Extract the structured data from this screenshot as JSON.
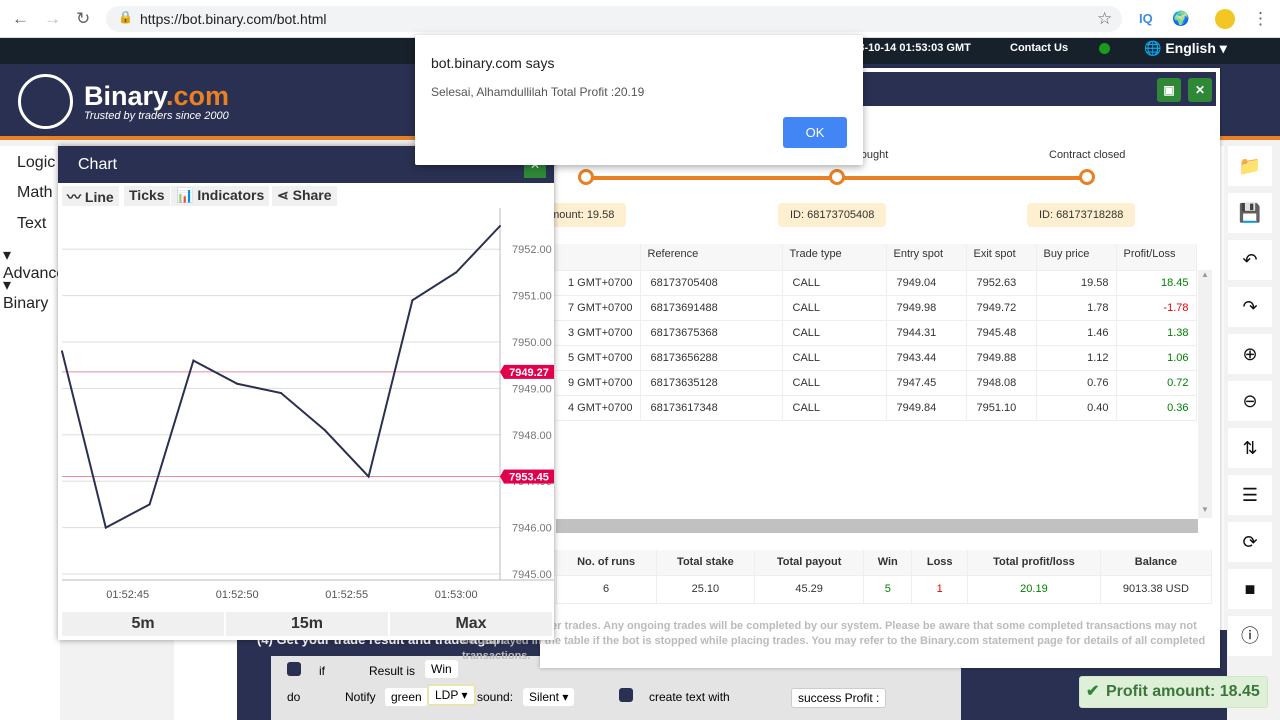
{
  "browser": {
    "url": "https://bot.binary.com/bot.html"
  },
  "topbar": {
    "time": "2018-10-14 01:53:03 GMT",
    "contact": "Contact Us",
    "language": "English"
  },
  "header": {
    "brand_main": "Binary",
    "brand_suffix": ".com",
    "tagline": "Trusted by traders since 2000"
  },
  "toolbox": {
    "items": [
      "Logic",
      "Math",
      "Text",
      "Advanced",
      "Binary"
    ]
  },
  "dialog": {
    "title": "bot.binary.com says",
    "message": "Selesai, Alhamdullilah Total Profit :20.19",
    "ok": "OK"
  },
  "steps": [
    {
      "label": "",
      "tip": "Buy amount: 19.58"
    },
    {
      "label": "Contract bought",
      "tip": "ID: 68173705408"
    },
    {
      "label": "Contract closed",
      "tip": "ID: 68173718288"
    }
  ],
  "trades": {
    "headers": [
      "Timestamp",
      "Reference",
      "Trade type",
      "Entry spot",
      "Exit spot",
      "Buy price",
      "Profit/Loss"
    ],
    "rows": [
      [
        "1 GMT+0700",
        "68173705408",
        "CALL",
        "7949.04",
        "7952.63",
        "19.58",
        "18.45"
      ],
      [
        "7 GMT+0700",
        "68173691488",
        "CALL",
        "7949.98",
        "7949.72",
        "1.78",
        "-1.78"
      ],
      [
        "3 GMT+0700",
        "68173675368",
        "CALL",
        "7944.31",
        "7945.48",
        "1.46",
        "1.38"
      ],
      [
        "5 GMT+0700",
        "68173656288",
        "CALL",
        "7943.44",
        "7949.88",
        "1.12",
        "1.06"
      ],
      [
        "9 GMT+0700",
        "68173635128",
        "CALL",
        "7947.45",
        "7948.08",
        "0.76",
        "0.72"
      ],
      [
        "4 GMT+0700",
        "68173617348",
        "CALL",
        "7949.84",
        "7951.10",
        "0.40",
        "0.36"
      ]
    ]
  },
  "summary": {
    "headers": [
      "No. of runs",
      "Total stake",
      "Total payout",
      "Win",
      "Loss",
      "Total profit/loss",
      "Balance"
    ],
    "values": [
      "6",
      "25.10",
      "45.29",
      "5",
      "1",
      "20.19",
      "9013.38 USD"
    ]
  },
  "notice": "Stopping the bot will prevent further trades. Any ongoing trades will be completed by our system. Please be aware that some completed transactions may not be displayed in the table if the bot is stopped while placing trades. You may refer to the Binary.com statement page for details of all completed transactions.",
  "blocks": {
    "comment": "(4) Get your trade result and trade again",
    "if": "if",
    "result_is": "Result is",
    "win": "Win",
    "do": "do",
    "notify": "Notify",
    "green": "green",
    "ldp": "LDP",
    "sound": "sound:",
    "silent": "Silent",
    "create_text": "create text with",
    "success": "success Profit :"
  },
  "toast": "Profit amount: 18.45",
  "sidebar_icons": [
    "folder-icon",
    "save-icon",
    "undo-icon",
    "redo-icon",
    "zoom-in-icon",
    "zoom-out-icon",
    "sort-icon",
    "list-icon",
    "refresh-icon",
    "stop-icon",
    "info-icon"
  ],
  "chart": {
    "title": "Chart",
    "tools": [
      "Line",
      "Ticks",
      "Indicators",
      "Share"
    ],
    "ranges": [
      "5m",
      "15m",
      "Max"
    ],
    "barriers": [
      {
        "label": "7949.27",
        "value": 7949.27
      },
      {
        "label": "7953.45",
        "value": 7953.45
      }
    ],
    "barrier_color": "#e0004d",
    "line_color": "#2a3052"
  },
  "chart_data": {
    "type": "line",
    "x": [
      "01:52:42",
      "01:52:44",
      "01:52:46",
      "01:52:48",
      "01:52:50",
      "01:52:52",
      "01:52:54",
      "01:52:56",
      "01:52:58",
      "01:53:00",
      "01:53:02"
    ],
    "values": [
      7949.8,
      7946.0,
      7946.5,
      7949.6,
      7949.1,
      7948.9,
      7948.1,
      7947.1,
      7950.9,
      7951.5,
      7952.5
    ],
    "xticks": [
      "01:52:45",
      "01:52:50",
      "01:52:55",
      "01:53:00"
    ],
    "yticks": [
      "7945.00",
      "7946.00",
      "7947.00",
      "7948.00",
      "7949.00",
      "7950.00",
      "7951.00",
      "7952.00"
    ],
    "ylim": [
      7945,
      7952.5
    ],
    "grid": true
  }
}
